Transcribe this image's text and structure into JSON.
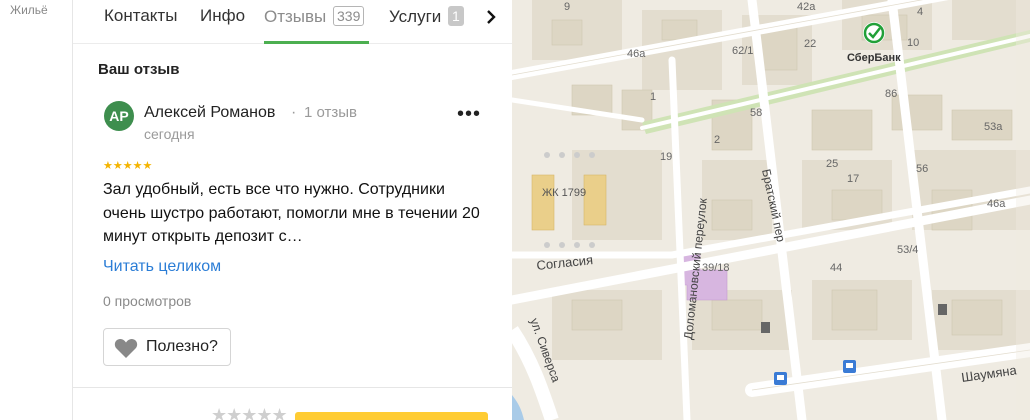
{
  "sidebar": {
    "label": "Жильё"
  },
  "tabs": [
    {
      "label": "Контакты"
    },
    {
      "label": "Инфо"
    },
    {
      "label": "Отзывы",
      "count": "339"
    },
    {
      "label": "Услуги",
      "count": "1"
    }
  ],
  "review_section": {
    "title": "Ваш отзыв",
    "avatar_initials": "АР",
    "author": "Алексей Романов",
    "separator": "·",
    "author_reviews": "1 отзыв",
    "date": "сегодня",
    "rating": 5,
    "stars": "★★★★★",
    "text": "Зал удобный, есть все что нужно. Сотрудники очень шустро работают, помогли мне в течении 20 минут открыть депозит с…",
    "read_more": "Читать целиком",
    "views": "0 просмотров",
    "useful_label": "Полезно?",
    "menu": "•••"
  },
  "bottom": {
    "stars": "★★★★★"
  },
  "map": {
    "labels": {
      "bank": "СберБанк",
      "complex": "ЖК 1799",
      "street_soglasiya": "Согласия",
      "street_domanovsky": "Доломановский переулок",
      "street_bratsky": "Братский пер",
      "street_shaumyana": "Шаумяна",
      "street_siversa": "ул. Сиверса"
    },
    "house_numbers": [
      "42а",
      "46а",
      "62/1",
      "1",
      "58",
      "86",
      "53а",
      "2",
      "19",
      "25",
      "56",
      "17",
      "46а",
      "39/18",
      "44",
      "53/4",
      "9",
      "4",
      "10",
      "22"
    ]
  },
  "colors": {
    "accent": "#4caf50",
    "link": "#2b7dd6",
    "star": "#f4b400",
    "avatar": "#3e8e4e",
    "cta": "#ffcc33"
  }
}
